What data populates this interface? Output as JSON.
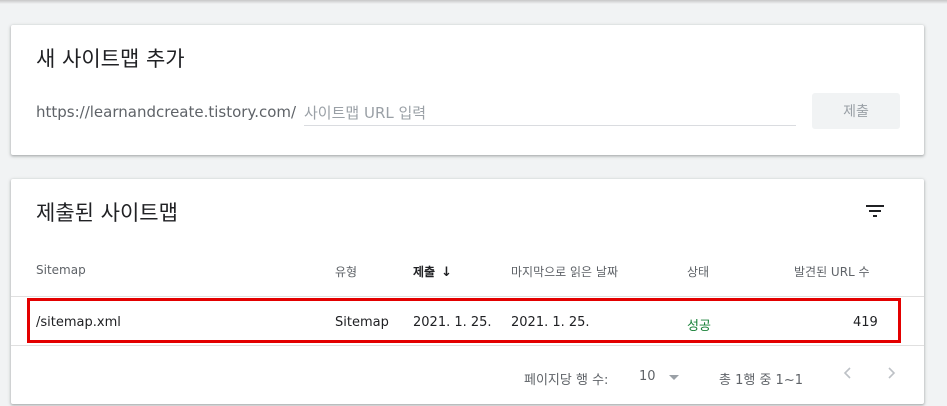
{
  "add_card": {
    "title": "새 사이트맵 추가",
    "url_prefix": "https://learnandcreate.tistory.com/",
    "input_placeholder": "사이트맵 URL 입력",
    "input_value": "",
    "submit_label": "제출"
  },
  "list_card": {
    "title": "제출된 사이트맵",
    "filter_icon": "filter-list-icon",
    "columns": {
      "sitemap": "Sitemap",
      "type": "유형",
      "submitted": "제출",
      "last_read": "마지막으로 읽은 날짜",
      "status": "상태",
      "discovered_urls": "발견된 URL 수"
    },
    "sort_icon": "arrow-down-icon",
    "rows": [
      {
        "sitemap": "/sitemap.xml",
        "type": "Sitemap",
        "submitted": "2021. 1. 25.",
        "last_read": "2021. 1. 25.",
        "status": "성공",
        "discovered_urls": "419"
      }
    ],
    "pagination": {
      "rows_per_page_label": "페이지당 행 수:",
      "rows_per_page_value": "10",
      "range_label": "총 1행 중 1~1",
      "prev_icon": "chevron-left-icon",
      "next_icon": "chevron-right-icon"
    }
  },
  "colors": {
    "status_success": "#188038",
    "highlight_border": "#e30000",
    "background": "#f1f3f4"
  }
}
